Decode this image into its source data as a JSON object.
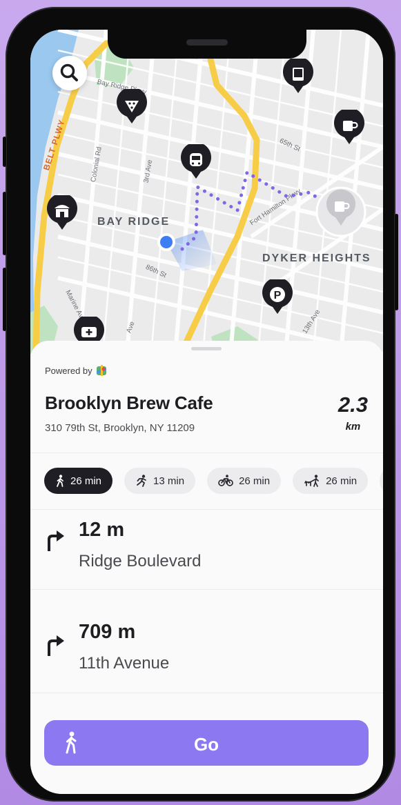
{
  "map": {
    "neighborhoods": [
      "BAY RIDGE",
      "DYKER HEIGHTS"
    ],
    "parkway_label": "BELT PLWY",
    "streets": [
      "Bay Ridge Pkwy",
      "Colonial Rd",
      "3rd Ave",
      "65th St",
      "Fort Hamilton Pkwy",
      "86th St",
      "Marine Ave",
      "Ave",
      "13th Ave"
    ],
    "pins": [
      "search-icon",
      "book-icon",
      "pizza-icon",
      "coffee-icon",
      "train-icon",
      "shop-icon",
      "parking-icon",
      "ambulance-icon"
    ],
    "parking_letter": "P",
    "route_color": "#8067e6",
    "user_dot_color": "#3f7ef2"
  },
  "sheet": {
    "powered_by": "Powered by",
    "place_name": "Brooklyn Brew Cafe",
    "address": "310 79th St, Brooklyn, NY 11209",
    "distance_value": "2.3",
    "distance_unit": "km",
    "modes": [
      {
        "icon": "walk-icon",
        "label": "26 min",
        "active": true
      },
      {
        "icon": "run-icon",
        "label": "13 min",
        "active": false
      },
      {
        "icon": "bike-icon",
        "label": "26 min",
        "active": false
      },
      {
        "icon": "dog-walk-icon",
        "label": "26 min",
        "active": false
      }
    ],
    "steps": [
      {
        "distance": "12 m",
        "street": "Ridge Boulevard",
        "icon": "turn-right-icon"
      },
      {
        "distance": "709 m",
        "street": "11th Avenue",
        "icon": "turn-right-icon"
      }
    ],
    "go_label": "Go",
    "accent_color": "#8c79f1"
  }
}
